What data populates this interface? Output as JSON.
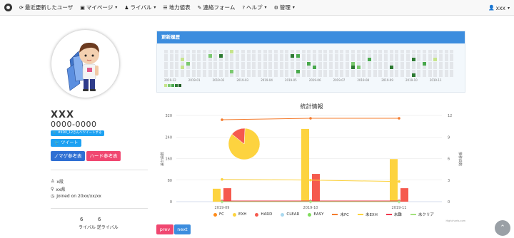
{
  "navbar": {
    "items": [
      {
        "icon": "refresh-icon",
        "glyph": "⟳",
        "label": "最近更新したユーザ",
        "caret": false
      },
      {
        "icon": "id-card-icon",
        "glyph": "▣",
        "label": "マイページ",
        "caret": true
      },
      {
        "icon": "rival-icon",
        "glyph": "♟",
        "label": "ライバル",
        "caret": true
      },
      {
        "icon": "database-icon",
        "glyph": "☰",
        "label": "地力値表",
        "caret": false
      },
      {
        "icon": "wrench-icon",
        "glyph": "✎",
        "label": "連絡フォーム",
        "caret": false
      },
      {
        "icon": "help-icon",
        "glyph": "?",
        "label": "ヘルプ",
        "caret": true
      },
      {
        "icon": "gear-icon",
        "glyph": "⚙",
        "label": "管理",
        "caret": true
      }
    ],
    "user_label": "xxx"
  },
  "profile": {
    "name": "XXX",
    "dj_code": "0000-0000",
    "tweet_share": "#IIDX_12さんへツイートする",
    "tweet_button": "ツイート",
    "normal_ref": "ノマゲ参考表",
    "hard_ref": "ハード参考表",
    "grade": "x段",
    "prefecture": "xx県",
    "joined": "Joined on 20xx/xx/xx",
    "rival_count": "6",
    "reverse_rival_count": "6",
    "rival_label": "ライバル 逆ライバル"
  },
  "history": {
    "title": "更新履歴",
    "months": [
      "2019-12",
      "2019-01",
      "2019-02",
      "2019-03",
      "2019-04",
      "2019-05",
      "2019-06",
      "2019-07",
      "2019-08",
      "2019-09",
      "2019-10",
      "2019-11"
    ]
  },
  "chart_data": {
    "type": "bar",
    "title": "統計情報",
    "categories": [
      "2019-09",
      "2019-10",
      "2019-11"
    ],
    "ylabel_left": "差分曲数",
    "ylabel_right": "推移曲数",
    "y_left_ticks": [
      "0",
      "80",
      "160",
      "240",
      "320"
    ],
    "y_right_ticks": [
      "0",
      "3",
      "6",
      "9",
      "12"
    ],
    "ylim_left": [
      0,
      320
    ],
    "ylim_right": [
      0,
      12
    ],
    "bar_series": [
      {
        "name": "FC",
        "color": "#ff8c1a",
        "values": [
          0,
          0,
          0
        ]
      },
      {
        "name": "EXH",
        "color": "#fdd33f",
        "values": [
          48,
          270,
          158
        ]
      },
      {
        "name": "HARD",
        "color": "#f55a4e",
        "values": [
          50,
          103,
          50
        ]
      },
      {
        "name": "CLEAR",
        "color": "#aad9f0",
        "values": [
          0,
          0,
          0
        ]
      },
      {
        "name": "EASY",
        "color": "#7fdc5c",
        "values": [
          0,
          0,
          0
        ]
      }
    ],
    "line_series": [
      {
        "name": "未FC",
        "color": "#f47c2e",
        "values": [
          11.4,
          11.6,
          11.6
        ]
      },
      {
        "name": "未EXH",
        "color": "#fdd33f",
        "values": [
          3.1,
          3.0,
          2.8
        ]
      },
      {
        "name": "未難",
        "color": "#f0394f",
        "values": [
          0.1,
          0.1,
          0.1
        ]
      },
      {
        "name": "未クリア",
        "color": "#a3e27e",
        "values": [
          0,
          0,
          0
        ]
      }
    ],
    "pie": [
      {
        "name": "EXH",
        "value": 85,
        "color": "#fdd33f"
      },
      {
        "name": "HARD",
        "value": 15,
        "color": "#f55a4e"
      }
    ],
    "legend_position": "bottom",
    "credit": "Highcharts.com"
  },
  "pager": {
    "prev": "prev",
    "next": "next"
  },
  "colors": {
    "primary": "#3c8dde",
    "twitter": "#1da1f2",
    "normal": "#2f6fd3",
    "hard": "#f04770"
  }
}
